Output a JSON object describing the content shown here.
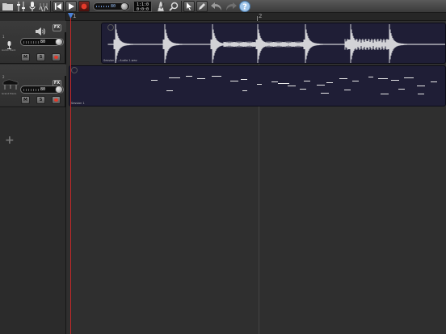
{
  "toolbar": {
    "tempo_value": "80",
    "lcd_line1": "1:1:0",
    "lcd_line2": "0:0:0",
    "metronome_text": "120"
  },
  "tracks": [
    {
      "number": "1",
      "name": "Audio Track",
      "volume": "80",
      "fx_label": "FX",
      "mute_label": "M",
      "solo_label": "S"
    },
    {
      "number": "2",
      "name": "Grand Piano",
      "volume": "80",
      "fx_label": "FX",
      "mute_label": "M",
      "solo_label": "S"
    }
  ],
  "timeline": {
    "bar_1": "1",
    "bar_2": "2"
  },
  "regions": [
    {
      "label": "Session 1 - Audio 1.wav"
    },
    {
      "label": "Session 1"
    }
  ],
  "colors": {
    "region_bg": "#1f1e36",
    "playhead": "#c62828",
    "record": "#e53a2a"
  }
}
